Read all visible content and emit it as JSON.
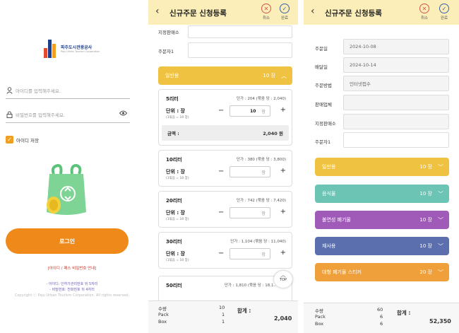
{
  "login": {
    "logo_text": "파주도시관광공사",
    "logo_sub": "Paju Urban Tourism Corporation",
    "id_placeholder": "아이디를 입력해주세요.",
    "pw_placeholder": "비밀번호를 입력해주세요.",
    "save_id_label": "아이디 저장",
    "login_label": "로그인",
    "find_link": "[아이디 / 패스 비밀번호 안내]",
    "info1": "- 아이디: 인허가관리번호 뒤 5자리",
    "info2": "- 비밀번호: 전화번호 뒤 4자리",
    "copyright": "Copyright ⓒ Paju Urban Tourism Corporation. All rights reserved."
  },
  "order": {
    "title": "신규주문 신청등록",
    "cancel_label": "취소",
    "done_label": "완료",
    "store_label": "지정판매소",
    "orderer_label": "주문자1",
    "category": {
      "name": "일반용",
      "qty": "10 장"
    },
    "items": [
      {
        "name": "5리터",
        "price": "단가 : 204 (묶음 당 : 2,040)",
        "unit": "단위 : 장",
        "unit_sub": "(1묶음 = 10 장)",
        "qty": "10",
        "qty_unit": "장",
        "amount_label": "금액 :",
        "amount": "2,040 원"
      },
      {
        "name": "10리터",
        "price": "단가 : 380 (묶음 당 : 3,800)",
        "unit": "단위 : 장",
        "unit_sub": "(1묶음 = 10 장)",
        "qty": "",
        "qty_unit": "장"
      },
      {
        "name": "20리터",
        "price": "단가 : 742 (묶음 당 : 7,420)",
        "unit": "단위 : 장",
        "unit_sub": "(1묶음 = 10 장)",
        "qty": "",
        "qty_unit": "장"
      },
      {
        "name": "30리터",
        "price": "단가 : 1,104 (묶음 당 : 11,040)",
        "unit": "단위 : 장",
        "unit_sub": "(1묶음 = 10 장)",
        "qty": "",
        "qty_unit": "장"
      },
      {
        "name": "50리터",
        "price": "단가 : 1,810 (묶음 당 : 18,1..",
        "unit": "",
        "unit_sub": "",
        "qty": "",
        "qty_unit": ""
      }
    ],
    "top_label": "TOP",
    "footer": {
      "qty_label": "수량",
      "qty": "10",
      "pack_label": "Pack",
      "pack": "1",
      "box_label": "Box",
      "box": "1",
      "total_label": "합계 :",
      "total": "2,040"
    }
  },
  "summary": {
    "title": "신규주문 신청등록",
    "cancel_label": "취소",
    "done_label": "완료",
    "order_date_label": "주문일",
    "order_date": "2024-10-08",
    "delivery_date_label": "배달일",
    "delivery_date": "2024-10-14",
    "method_label": "주문방법",
    "method": "인터넷접수",
    "seller_label": "판매업체",
    "store_label": "지정판매소",
    "orderer_label": "주문자1",
    "categories": [
      {
        "name": "일반용",
        "qty": "10 장",
        "color": "#f0c242"
      },
      {
        "name": "음식물",
        "qty": "10 장",
        "color": "#6cc4b4"
      },
      {
        "name": "불연성 폐기물",
        "qty": "10 장",
        "color": "#a05bb8"
      },
      {
        "name": "재사용",
        "qty": "10 장",
        "color": "#5b6fae"
      },
      {
        "name": "대형 폐기물 스티커",
        "qty": "20 장",
        "color": "#f0a03a"
      }
    ],
    "footer": {
      "qty_label": "수량",
      "qty": "60",
      "pack_label": "Pack",
      "pack": "6",
      "box_label": "Box",
      "box": "6",
      "total_label": "합계 :",
      "total": "52,350"
    }
  }
}
